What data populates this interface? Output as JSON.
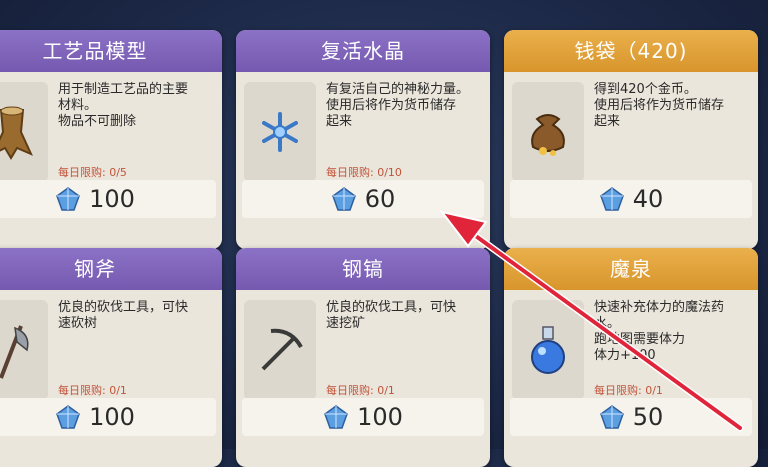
{
  "cards": [
    {
      "title": "工艺品模型",
      "desc": "用于制造工艺品的主要\n材料。\n物品不可删除",
      "limit": "每日限购: 0/5",
      "price": "100",
      "icon": "wood-log-icon"
    },
    {
      "title": "复活水晶",
      "desc": "有复活自己的神秘力量。\n使用后将作为货币储存\n起来",
      "limit": "每日限购: 0/10",
      "price": "60",
      "icon": "snowflake-crystal-icon"
    },
    {
      "title": "钱袋（420)",
      "desc": "得到420个金币。\n使用后将作为货币储存\n起来",
      "limit": "",
      "price": "40",
      "icon": "money-bag-icon"
    },
    {
      "title": "钢斧",
      "desc": "优良的砍伐工具，可快\n速砍树",
      "limit": "每日限购: 0/1",
      "price": "100",
      "icon": "axe-icon"
    },
    {
      "title": "钢镐",
      "desc": "优良的砍伐工具，可快\n速挖矿",
      "limit": "每日限购: 0/1",
      "price": "100",
      "icon": "pickaxe-icon"
    },
    {
      "title": "魔泉",
      "desc": "快速补充体力的魔法药\n水。\n跑地图需要体力\n体力+100",
      "limit": "每日限购: 0/1",
      "price": "50",
      "icon": "potion-icon"
    }
  ],
  "colors": {
    "purple": "#7e63bb",
    "gold": "#e0a23a",
    "annotation_arrow": "#e0243a"
  }
}
